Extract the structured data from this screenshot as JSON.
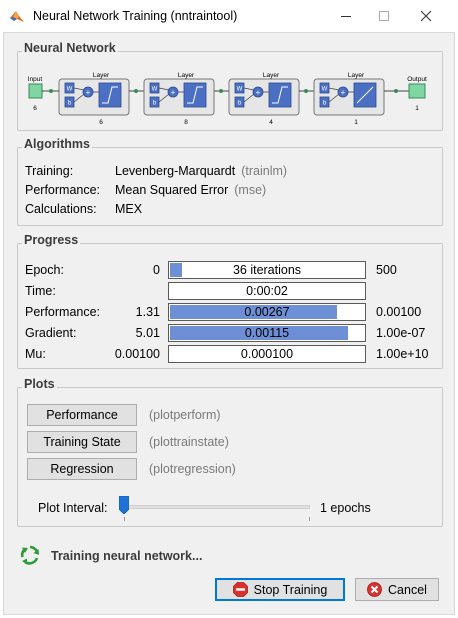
{
  "window": {
    "title": "Neural Network Training (nntraintool)",
    "icon": "matlab-icon",
    "controls": [
      "minimize-icon",
      "maximize-icon",
      "close-icon"
    ]
  },
  "network": {
    "section_title": "Neural Network",
    "input_label": "Input",
    "input_size": "6",
    "output_label": "Output",
    "output_size": "1",
    "layers": [
      {
        "label": "Layer",
        "size": "6"
      },
      {
        "label": "Layer",
        "size": "8"
      },
      {
        "label": "Layer",
        "size": "4"
      },
      {
        "label": "Layer",
        "size": "1"
      }
    ],
    "weight_label": "W",
    "bias_label": "b"
  },
  "algorithms": {
    "section_title": "Algorithms",
    "rows": [
      {
        "label": "Training:",
        "value": "Levenberg-Marquardt",
        "paren": "(trainlm)"
      },
      {
        "label": "Performance:",
        "value": "Mean Squared Error",
        "paren": "(mse)"
      },
      {
        "label": "Calculations:",
        "value": "MEX",
        "paren": ""
      }
    ]
  },
  "progress": {
    "section_title": "Progress",
    "rows": [
      {
        "label": "Epoch:",
        "min": "0",
        "text": "36 iterations",
        "max": "500",
        "fill": 0.07
      },
      {
        "label": "Time:",
        "min": "",
        "text": "0:00:02",
        "max": "",
        "fill": 0
      },
      {
        "label": "Performance:",
        "min": "1.31",
        "text": "0.00267",
        "max": "0.00100",
        "fill": 0.86
      },
      {
        "label": "Gradient:",
        "min": "5.01",
        "text": "0.00115",
        "max": "1.00e-07",
        "fill": 0.92
      },
      {
        "label": "Mu:",
        "min": "0.00100",
        "text": "0.000100",
        "max": "1.00e+10",
        "fill": 0
      }
    ],
    "fill_color": "#6e8fd6"
  },
  "plots": {
    "section_title": "Plots",
    "buttons": [
      {
        "label": "Performance",
        "paren": "(plotperform)"
      },
      {
        "label": "Training State",
        "paren": "(plottrainstate)"
      },
      {
        "label": "Regression",
        "paren": "(plotregression)"
      }
    ],
    "interval_label": "Plot Interval:",
    "interval_value": "1 epochs"
  },
  "status": {
    "icon": "recycle-icon",
    "text": "Training neural network..."
  },
  "actions": {
    "stop_label": "Stop Training",
    "stop_icon": "stop-icon",
    "cancel_label": "Cancel",
    "cancel_icon": "cancel-icon"
  }
}
